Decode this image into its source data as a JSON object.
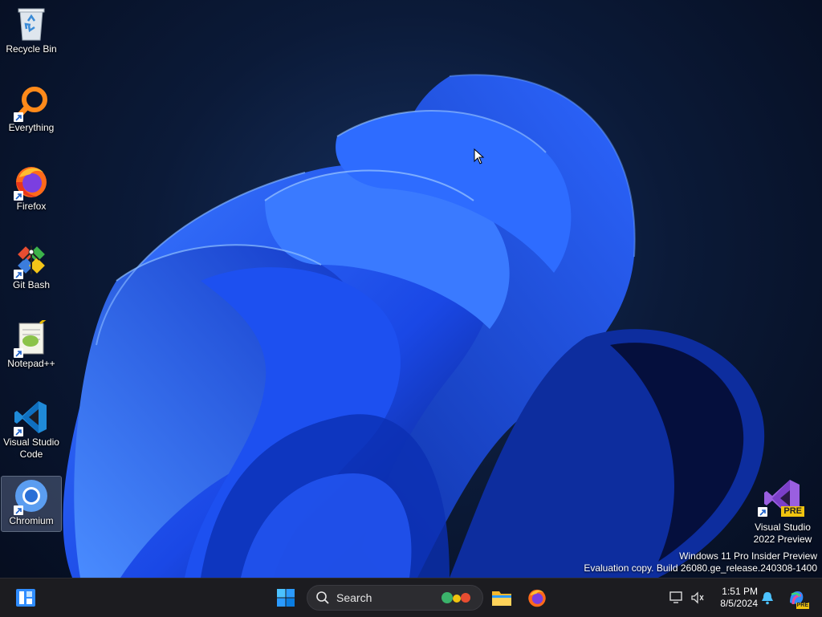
{
  "desktop": {
    "icons": [
      {
        "label": "Recycle Bin",
        "icon": "recycle-bin-icon"
      },
      {
        "label": "Everything",
        "icon": "everything-search-icon"
      },
      {
        "label": "Firefox",
        "icon": "firefox-icon"
      },
      {
        "label": "Git Bash",
        "icon": "git-bash-icon"
      },
      {
        "label": "Notepad++",
        "icon": "notepad-plus-plus-icon"
      },
      {
        "label": "Visual Studio Code",
        "label_line1": "Visual Studio",
        "label_line2": "Code",
        "icon": "vscode-icon"
      },
      {
        "label": "Chromium",
        "icon": "chromium-icon",
        "selected": true
      }
    ],
    "right_icon": {
      "label_line1": "Visual Studio",
      "label_line2": "2022 Preview",
      "badge": "PRE",
      "icon": "visual-studio-preview-icon"
    }
  },
  "watermark": {
    "line1": "Windows 11 Pro Insider Preview",
    "line2": "Evaluation copy. Build 26080.ge_release.240308-1400"
  },
  "taskbar": {
    "search_label": "Search",
    "clock_time": "1:51 PM",
    "clock_date": "8/5/2024",
    "copilot_badge": "PRE"
  },
  "colors": {
    "wallpaper_bg": "#0b1a38",
    "bloom_blue": "#1f55ff",
    "taskbar": "#1c1c20",
    "accent": "#2f8cff"
  }
}
